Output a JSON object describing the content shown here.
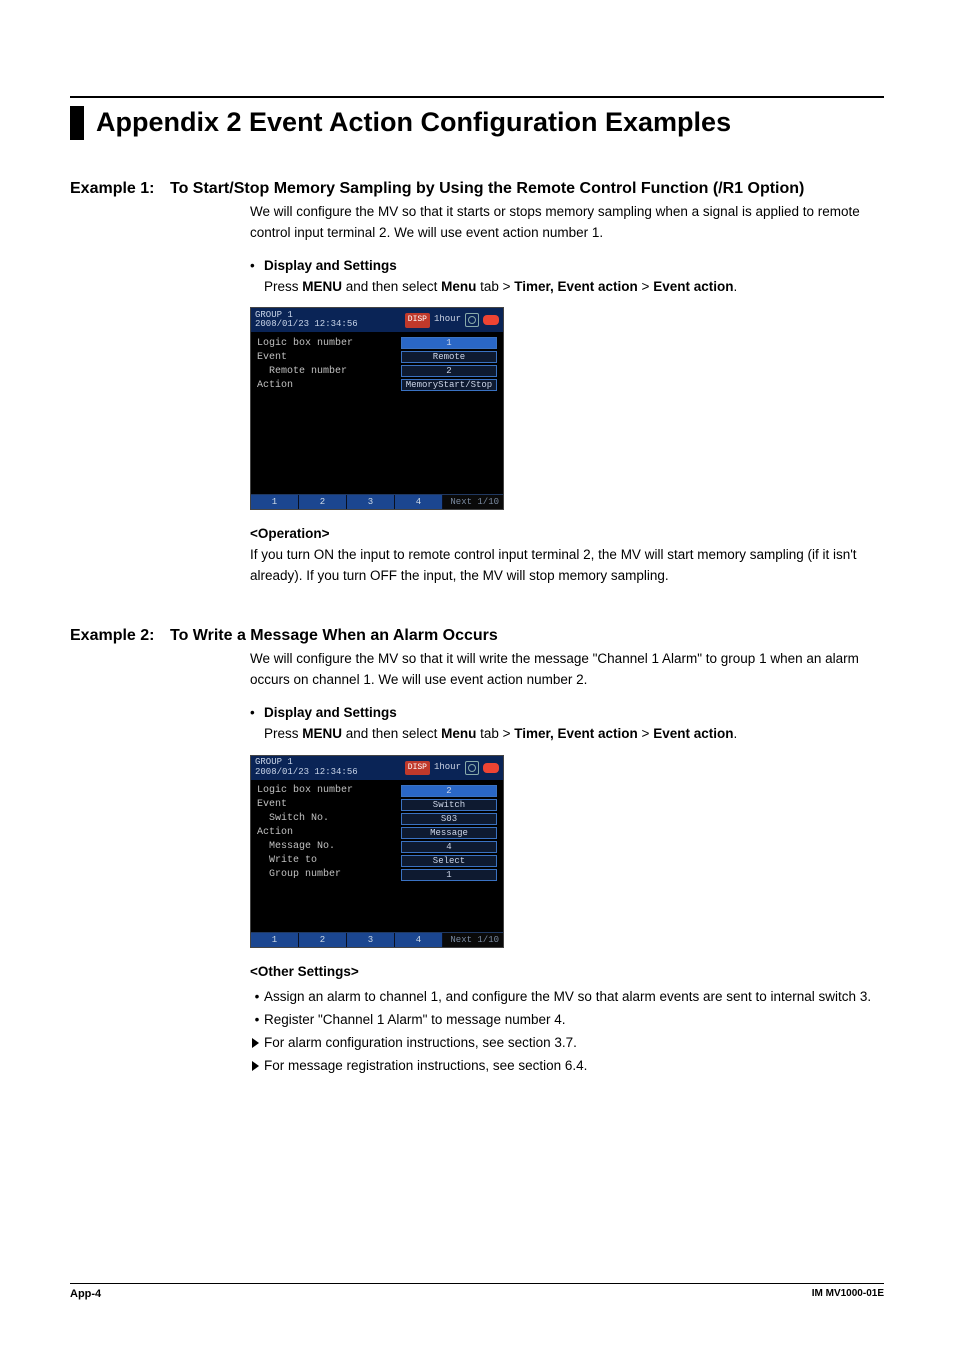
{
  "title": "Appendix 2  Event Action Configuration Examples",
  "ex1": {
    "label": "Example 1:",
    "title": "To Start/Stop Memory Sampling by Using the Remote Control Function (/R1 Option)",
    "intro": "We will configure the MV so that it starts or stops memory sampling when a signal is applied to remote control input terminal 2. We will use event action number 1.",
    "ds_label": "Display and Settings",
    "press_pre": "Press ",
    "press_b1": "MENU",
    "press_mid1": " and then select ",
    "press_b2": "Menu",
    "press_mid2": " tab > ",
    "press_b3": "Timer, Event action",
    "press_mid3": " > ",
    "press_b4": "Event action",
    "press_end": ".",
    "scr": {
      "group": "GROUP 1",
      "ts": "2008/01/23 12:34:56",
      "disp": "DISP",
      "time": "1hour",
      "logic": "Logic box number",
      "logic_v": "1",
      "event": "Event",
      "event_v": "Remote",
      "remno": "  Remote number",
      "remno_v": "2",
      "action": "Action",
      "action_v": "MemoryStart/Stop",
      "t1": "1",
      "t2": "2",
      "t3": "3",
      "t4": "4",
      "next": "Next 1/10"
    },
    "op_h": "<Operation>",
    "op_t": "If you turn ON the input to remote control input terminal 2, the MV will start memory sampling (if it isn't already). If you turn OFF the input, the MV will stop memory sampling."
  },
  "ex2": {
    "label": "Example 2:",
    "title": "To Write a Message When an Alarm Occurs",
    "intro": "We will configure the MV so that it will write the message \"Channel 1 Alarm\" to group 1 when an alarm occurs on channel 1. We will use event action number 2.",
    "ds_label": "Display and Settings",
    "press_pre": "Press ",
    "press_b1": "MENU",
    "press_mid1": " and then select ",
    "press_b2": "Menu",
    "press_mid2": " tab > ",
    "press_b3": "Timer, Event action",
    "press_mid3": " > ",
    "press_b4": "Event action",
    "press_end": ".",
    "scr": {
      "group": "GROUP 1",
      "ts": "2008/01/23 12:34:56",
      "disp": "DISP",
      "time": "1hour",
      "logic": "Logic box number",
      "logic_v": "2",
      "event": "Event",
      "event_v": "Switch",
      "swno": "  Switch No.",
      "swno_v": "S03",
      "action": "Action",
      "action_v": "Message",
      "msgno": "  Message No.",
      "msgno_v": "4",
      "writeto": "  Write to",
      "writeto_v": "Select",
      "grpno": "  Group number",
      "grpno_v": "1",
      "t1": "1",
      "t2": "2",
      "t3": "3",
      "t4": "4",
      "next": "Next 1/10"
    },
    "oth_h": "<Other Settings>",
    "oth_i1": "Assign an alarm to channel 1, and configure the MV so that alarm events are sent to internal switch 3.",
    "oth_i2": "Register \"Channel 1 Alarm\" to message number 4.",
    "oth_i3": "For alarm configuration instructions, see section 3.7.",
    "oth_i4": "For message registration instructions, see section 6.4."
  },
  "footer": {
    "l": "App-4",
    "r": "IM MV1000-01E"
  }
}
